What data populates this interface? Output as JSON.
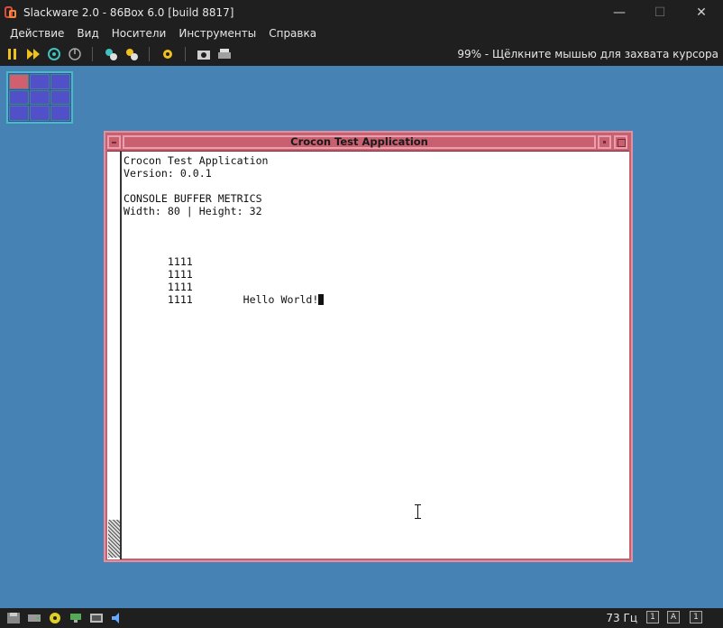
{
  "window": {
    "title": "Slackware 2.0 - 86Box 6.0 [build 8817]",
    "controls": {
      "minimize": "—",
      "maximize": "☐",
      "close": "✕"
    }
  },
  "menu": {
    "items": [
      "Действие",
      "Вид",
      "Носители",
      "Инструменты",
      "Справка"
    ]
  },
  "toolbar": {
    "icons": [
      "pause-icon",
      "fast-forward-icon",
      "reset-icon",
      "ctrl-alt-del-icon",
      "hard-reset-icon",
      "settings-icon",
      "screenshot-icon",
      "printer-icon"
    ],
    "status": "99% - Щёлкните мышью для захвата курсора"
  },
  "desktop": {
    "pager": {
      "rows": 3,
      "cols": 3,
      "active_cell": 0
    },
    "xterm": {
      "title": "Crocon Test Application",
      "lines": [
        "Crocon Test Application",
        "Version: 0.0.1",
        "",
        "CONSOLE BUFFER METRICS",
        "Width: 80 | Height: 32",
        "",
        "",
        "",
        "       1111",
        "       1111",
        "       1111",
        "       1111        Hello World!"
      ]
    }
  },
  "statusbar": {
    "refresh": "73 Гц",
    "indicators": [
      "1",
      "A",
      "1"
    ]
  },
  "colors": {
    "desktop": "#4682b4",
    "xterm_frame": "#c86070",
    "pager_active": "#d06070"
  }
}
